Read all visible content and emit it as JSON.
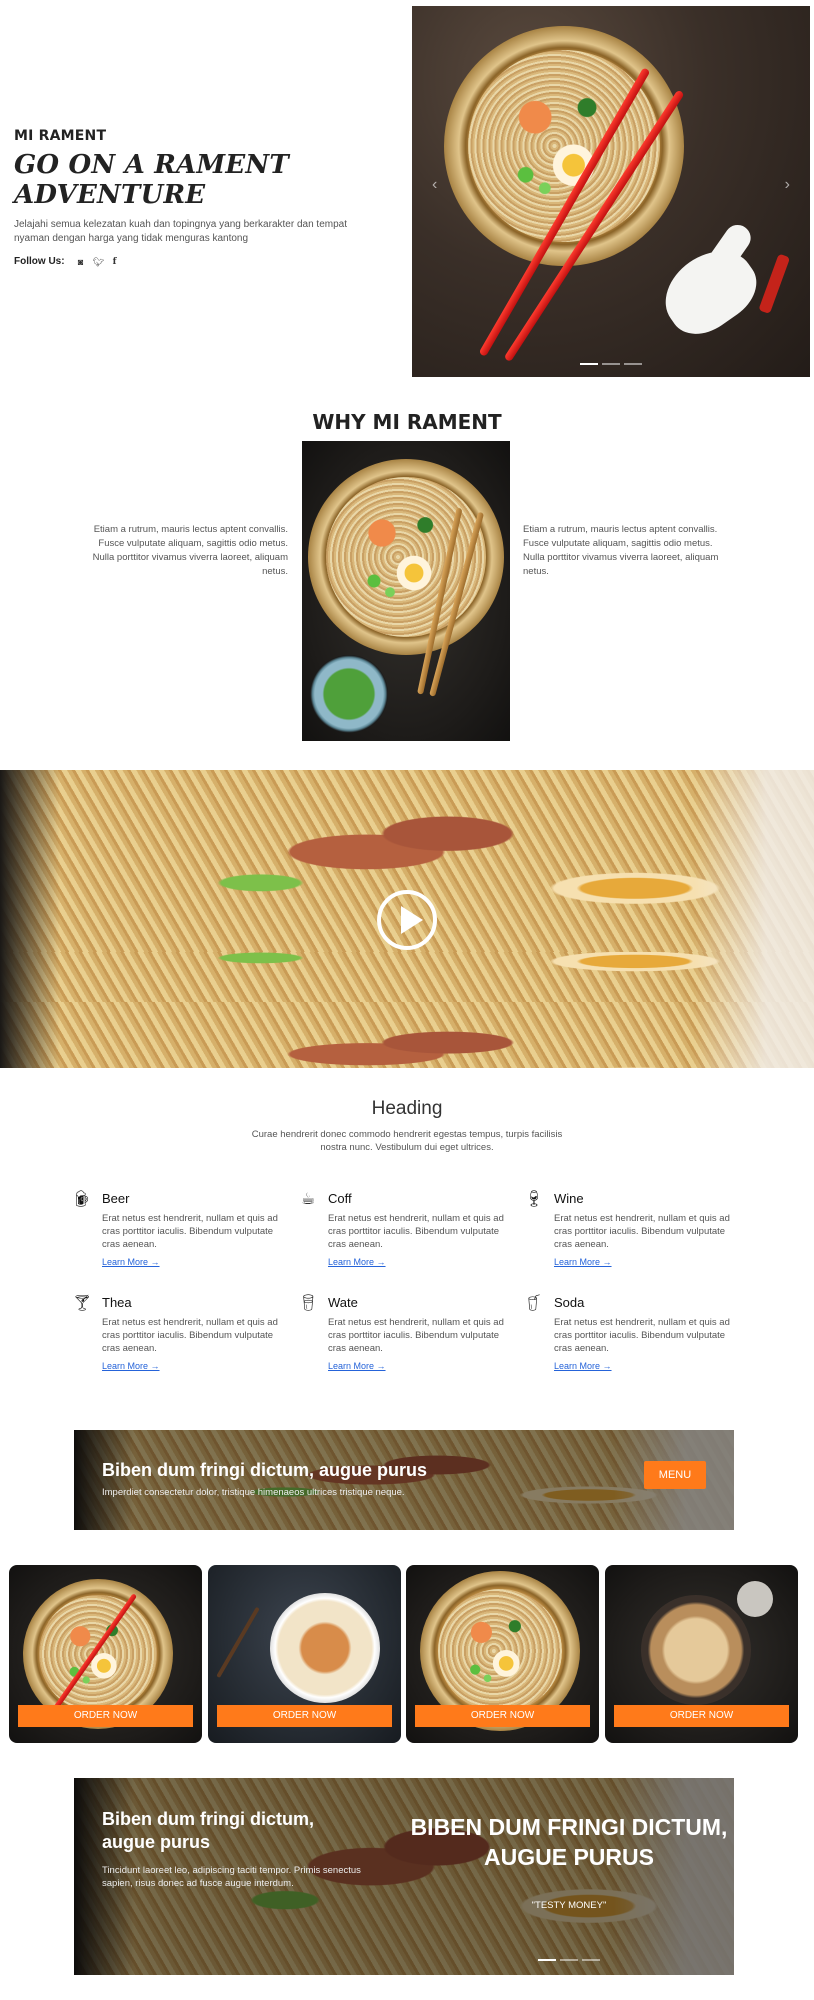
{
  "hero": {
    "eyebrow": "MI RAMENT",
    "title": "GO ON A RAMENT ADVENTURE",
    "description": "Jelajahi semua kelezatan kuah dan topingnya yang berkarakter dan tempat nyaman dengan harga yang tidak menguras kantong",
    "follow_label": "Follow Us:",
    "social_icons": [
      "instagram-icon",
      "twitter-icon",
      "facebook-icon"
    ],
    "prev_arrow": "‹",
    "next_arrow": "›"
  },
  "why": {
    "title": "WHY MI RAMENT",
    "left_text": "Etiam a rutrum, mauris lectus aptent convallis. Fusce vulputate aliquam, sagittis odio metus. Nulla porttitor vivamus viverra laoreet, aliquam netus.",
    "right_text": "Etiam a rutrum, mauris lectus aptent convallis. Fusce vulputate aliquam, sagittis odio metus. Nulla porttitor vivamus viverra laoreet, aliquam netus."
  },
  "features": {
    "heading": "Heading",
    "subheading": "Curae hendrerit donec commodo hendrerit egestas tempus, turpis facilisis nostra nunc. Vestibulum dui eget ultrices.",
    "items": [
      {
        "title": "Beer",
        "icon": "beer-mug-icon",
        "text": "Erat netus est hendrerit, nullam et quis ad cras porttitor iaculis. Bibendum vulputate cras aenean.",
        "link": "Learn More →"
      },
      {
        "title": "Coff",
        "icon": "coffee-cup-icon",
        "text": "Erat netus est hendrerit, nullam et quis ad cras porttitor iaculis. Bibendum vulputate cras aenean.",
        "link": "Learn More →"
      },
      {
        "title": "Wine",
        "icon": "wine-glass-icon",
        "text": "Erat netus est hendrerit, nullam et quis ad cras porttitor iaculis. Bibendum vulputate cras aenean.",
        "link": "Learn More →"
      },
      {
        "title": "Thea",
        "icon": "goblet-icon",
        "text": "Erat netus est hendrerit, nullam et quis ad cras porttitor iaculis. Bibendum vulputate cras aenean.",
        "link": "Learn More →"
      },
      {
        "title": "Wate",
        "icon": "water-glass-icon",
        "text": "Erat netus est hendrerit, nullam et quis ad cras porttitor iaculis. Bibendum vulputate cras aenean.",
        "link": "Learn More →"
      },
      {
        "title": "Soda",
        "icon": "soda-glass-icon",
        "text": "Erat netus est hendrerit, nullam et quis ad cras porttitor iaculis. Bibendum vulputate cras aenean.",
        "link": "Learn More →"
      }
    ]
  },
  "cta": {
    "title": "Biben dum fringi dictum, augue purus",
    "text": "Imperdiet consectetur dolor, tristique himenaeos ultrices tristique neque.",
    "button": "MENU"
  },
  "cards": [
    {
      "button": "ORDER NOW"
    },
    {
      "button": "ORDER NOW"
    },
    {
      "button": "ORDER NOW"
    },
    {
      "button": "ORDER NOW"
    }
  ],
  "bottom": {
    "title": "Biben dum fringi dictum, augue purus",
    "text": "Tincidunt laoreet leo, adipiscing taciti tempor. Primis senectus sapien, risus donec ad fusce augue interdum.",
    "big_title": "BIBEN DUM FRINGI DICTUM, AUGUE PURUS",
    "quote": "\"TESTY MONEY\""
  },
  "colors": {
    "accent": "#ff7a1a",
    "link": "#2563d9",
    "text": "#222222"
  }
}
